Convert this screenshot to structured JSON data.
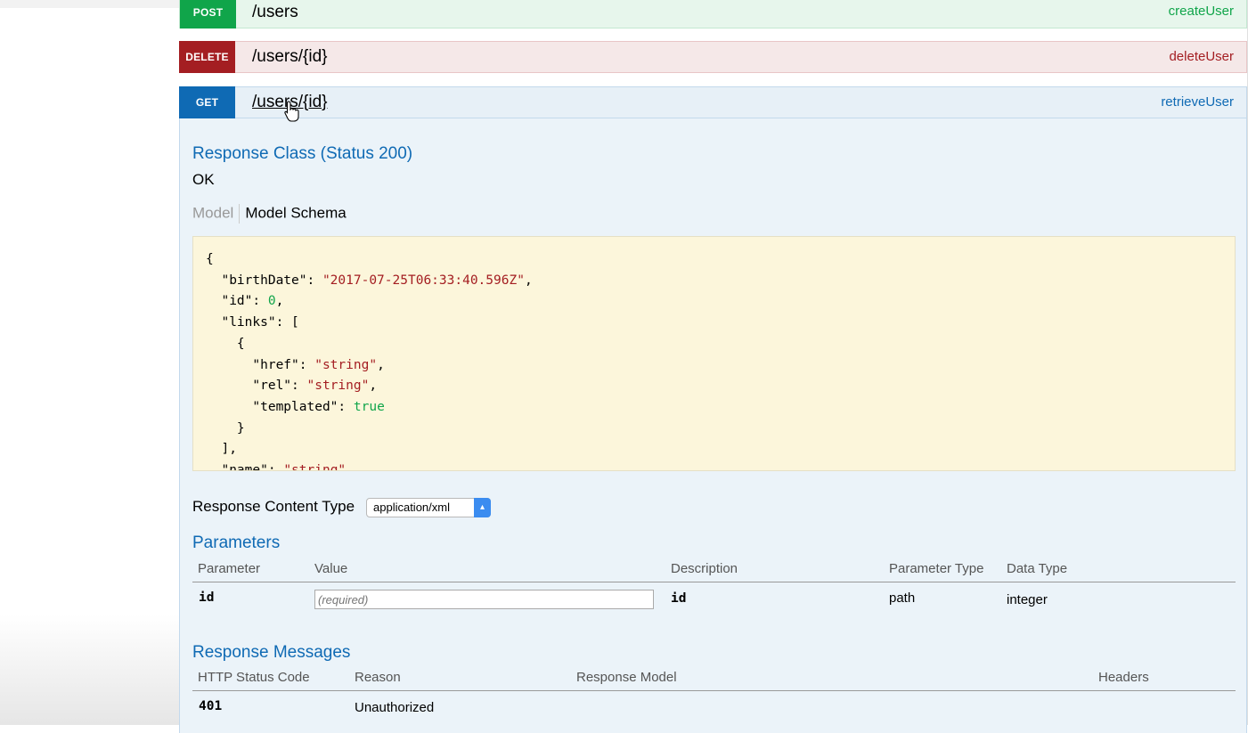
{
  "operations": [
    {
      "verb": "POST",
      "path": "/users",
      "nickname": "createUser"
    },
    {
      "verb": "DELETE",
      "path": "/users/{id}",
      "nickname": "deleteUser"
    },
    {
      "verb": "GET",
      "path": "/users/{id}",
      "nickname": "retrieveUser"
    }
  ],
  "response_class": {
    "heading": "Response Class (Status 200)",
    "description": "OK",
    "tabs": [
      "Model",
      "Model Schema"
    ]
  },
  "schema_lines": [
    {
      "parts": [
        {
          "t": "{",
          "c": "p"
        }
      ]
    },
    {
      "parts": [
        {
          "t": "  \"birthDate\": ",
          "c": "p"
        },
        {
          "t": "\"2017-07-25T06:33:40.596Z\"",
          "c": "s"
        },
        {
          "t": ",",
          "c": "p"
        }
      ]
    },
    {
      "parts": [
        {
          "t": "  \"id\": ",
          "c": "p"
        },
        {
          "t": "0",
          "c": "n"
        },
        {
          "t": ",",
          "c": "p"
        }
      ]
    },
    {
      "parts": [
        {
          "t": "  \"links\": [",
          "c": "p"
        }
      ]
    },
    {
      "parts": [
        {
          "t": "    {",
          "c": "p"
        }
      ]
    },
    {
      "parts": [
        {
          "t": "      \"href\": ",
          "c": "p"
        },
        {
          "t": "\"string\"",
          "c": "s"
        },
        {
          "t": ",",
          "c": "p"
        }
      ]
    },
    {
      "parts": [
        {
          "t": "      \"rel\": ",
          "c": "p"
        },
        {
          "t": "\"string\"",
          "c": "s"
        },
        {
          "t": ",",
          "c": "p"
        }
      ]
    },
    {
      "parts": [
        {
          "t": "      \"templated\": ",
          "c": "p"
        },
        {
          "t": "true",
          "c": "n"
        }
      ]
    },
    {
      "parts": [
        {
          "t": "    }",
          "c": "p"
        }
      ]
    },
    {
      "parts": [
        {
          "t": "  ],",
          "c": "p"
        }
      ]
    },
    {
      "parts": [
        {
          "t": "  \"name\": ",
          "c": "p"
        },
        {
          "t": "\"string\"",
          "c": "s"
        }
      ]
    }
  ],
  "response_content_type": {
    "label": "Response Content Type",
    "selected": "application/xml"
  },
  "parameters": {
    "heading": "Parameters",
    "columns": [
      "Parameter",
      "Value",
      "Description",
      "Parameter Type",
      "Data Type"
    ],
    "rows": [
      {
        "name": "id",
        "placeholder": "(required)",
        "description": "id",
        "param_type": "path",
        "data_type": "integer"
      }
    ]
  },
  "response_messages": {
    "heading": "Response Messages",
    "columns": [
      "HTTP Status Code",
      "Reason",
      "Response Model",
      "Headers"
    ],
    "rows": [
      {
        "code": "401",
        "reason": "Unauthorized"
      }
    ]
  },
  "colors": {
    "post": "#10a54a",
    "delete": "#a41e22",
    "get": "#0f6ab4",
    "snippet_bg": "#fcf6db"
  }
}
